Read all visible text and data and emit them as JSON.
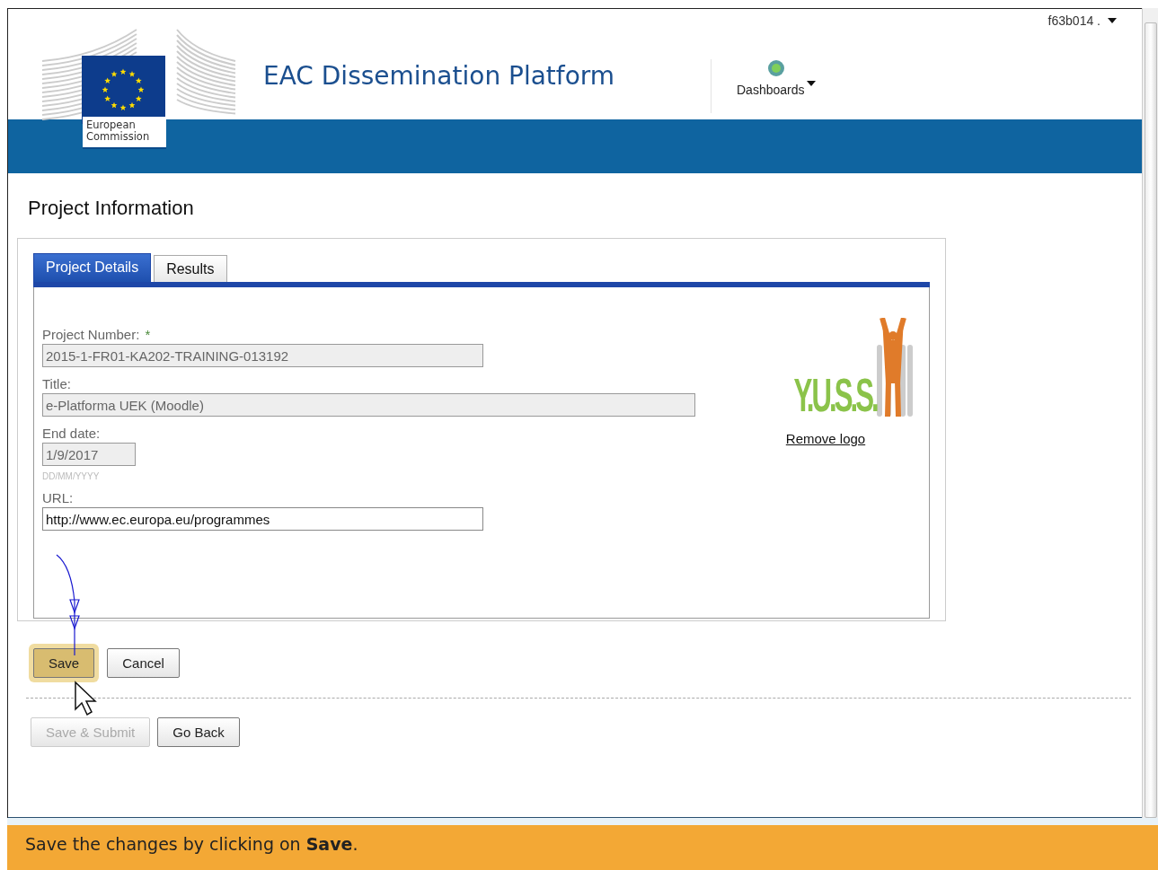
{
  "header": {
    "logo_caption": "European Commission",
    "title": "EAC Dissemination Platform",
    "dashboards_label": "Dashboards",
    "user_menu": "f63b014 ."
  },
  "page_title": "Project Information",
  "tabs": [
    {
      "label": "Project Details",
      "selected": true
    },
    {
      "label": "Results",
      "selected": false
    }
  ],
  "fields": [
    {
      "kind": "text",
      "label": "Project Number:",
      "required_mark": "*",
      "value": "2015-1-FR01-KA202-TRAINING-013192",
      "disabled": true
    },
    {
      "kind": "wide",
      "label": "Title:",
      "value": "e-Platforma UEK (Moodle)",
      "disabled": true
    },
    {
      "kind": "date",
      "label": "End date:",
      "value": "1/9/2017",
      "hint": "DD/MM/YYYY",
      "disabled": true
    },
    {
      "kind": "text",
      "label": "URL:",
      "value": "http://www.ec.europa.eu/programmes",
      "disabled": false
    }
  ],
  "logo": {
    "text": "Y.U.S.S.",
    "remove_link": "Remove logo"
  },
  "buttons": [
    {
      "label": "Save",
      "highlighted": true,
      "disabled": false
    },
    {
      "label": "Cancel",
      "highlighted": false,
      "disabled": false
    }
  ],
  "secondary_buttons": [
    {
      "label": "Save & Submit",
      "highlighted": false,
      "disabled": true
    },
    {
      "label": "Go Back",
      "highlighted": false,
      "disabled": false
    }
  ],
  "banner": "Save the changes by clicking on **Save**."
}
